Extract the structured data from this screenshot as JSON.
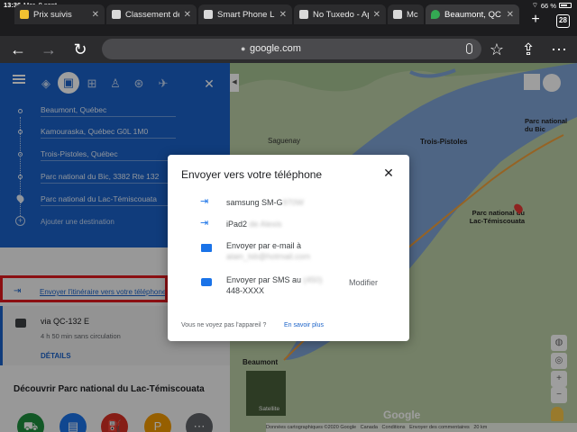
{
  "status_bar": {
    "time": "13:36",
    "date": "Mar. 8 sept.",
    "battery": "66 %"
  },
  "tabs": [
    {
      "title": "Prix suivis",
      "icon_color": "#f2c231"
    },
    {
      "title": "Classement de",
      "icon_color": "#d9d9d9"
    },
    {
      "title": "Smart Phone L",
      "icon_color": "#d9d9d9"
    },
    {
      "title": "No Tuxedo - Ap",
      "icon_color": "#d9d9d9"
    },
    {
      "title": "Mc",
      "icon_color": "#d9d9d9"
    },
    {
      "title": "Beaumont, QC",
      "icon_color": "#34a853"
    }
  ],
  "tab_count": "28",
  "toolbar": {
    "url": "google.com"
  },
  "sidebar": {
    "waypoints": [
      "Beaumont, Québec",
      "Kamouraska, Québec G0L 1M0",
      "Trois-Pistoles, Québec",
      "Parc national du Bic, 3382 Rte 132",
      "Parc national du Lac-Témiscouata"
    ],
    "add_destination": "Ajouter une destination",
    "send_link": "Envoyer l'itinéraire vers votre téléphone",
    "route": {
      "via": "via QC-132 E",
      "duration": "4 h 50 min sans circulation",
      "details": "DÉTAILS"
    },
    "discover_title": "Découvrir Parc national du Lac-Témiscouata"
  },
  "dialog": {
    "title": "Envoyer vers votre téléphone",
    "devices": [
      {
        "label": "samsung SM-G",
        "blurred": "970W",
        "icon": "phone-send-icon"
      },
      {
        "label": "iPad2 ",
        "blurred": "de Alexis",
        "icon": "phone-send-icon"
      }
    ],
    "email": {
      "label": "Envoyer par e-mail à",
      "blurred": "alain_lsb@hotmail.com"
    },
    "sms": {
      "label": "Envoyer par SMS au ",
      "blurred": "(450)",
      "number": "448-XXXX",
      "modify": "Modifier"
    },
    "footer_text": "Vous ne voyez pas l'appareil ?",
    "footer_link": "En savoir plus"
  },
  "map": {
    "labels": [
      "Saguenay",
      "Trois-Pistoles",
      "Parc national du Bic",
      "Parc national du Lac-Témiscouata",
      "Beaumont"
    ],
    "layer_label": "Satellite",
    "footer": [
      "Données cartographiques ©2020 Google",
      "Canada",
      "Conditions",
      "Envoyer des commentaires",
      "20 km"
    ]
  }
}
